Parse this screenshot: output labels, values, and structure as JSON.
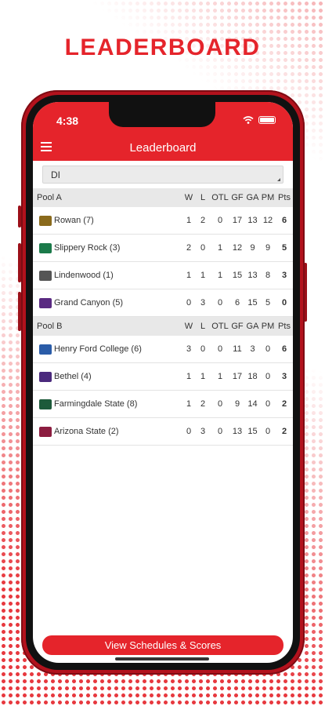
{
  "headline": "LEADERBOARD",
  "status": {
    "time": "4:38"
  },
  "nav": {
    "title": "Leaderboard"
  },
  "filter": {
    "selected": "DI"
  },
  "columns": [
    "W",
    "L",
    "OTL",
    "GF",
    "GA",
    "PM",
    "Pts"
  ],
  "pools": [
    {
      "name": "Pool A",
      "teams": [
        {
          "name": "Rowan (7)",
          "logo_color": "#8a6a1c",
          "w": "1",
          "l": "2",
          "otl": "0",
          "gf": "17",
          "ga": "13",
          "pm": "12",
          "pts": "6"
        },
        {
          "name": "Slippery Rock (3)",
          "logo_color": "#1b7a4a",
          "w": "2",
          "l": "0",
          "otl": "1",
          "gf": "12",
          "ga": "9",
          "pm": "9",
          "pts": "5"
        },
        {
          "name": "Lindenwood (1)",
          "logo_color": "#555555",
          "w": "1",
          "l": "1",
          "otl": "1",
          "gf": "15",
          "ga": "13",
          "pm": "8",
          "pts": "3"
        },
        {
          "name": "Grand Canyon (5)",
          "logo_color": "#5a2a82",
          "w": "0",
          "l": "3",
          "otl": "0",
          "gf": "6",
          "ga": "15",
          "pm": "5",
          "pts": "0"
        }
      ]
    },
    {
      "name": "Pool B",
      "teams": [
        {
          "name": "Henry Ford College (6)",
          "logo_color": "#2a5ca8",
          "w": "3",
          "l": "0",
          "otl": "0",
          "gf": "11",
          "ga": "3",
          "pm": "0",
          "pts": "6"
        },
        {
          "name": "Bethel (4)",
          "logo_color": "#4b2a7d",
          "w": "1",
          "l": "1",
          "otl": "1",
          "gf": "17",
          "ga": "18",
          "pm": "0",
          "pts": "3"
        },
        {
          "name": "Farmingdale State (8)",
          "logo_color": "#1d5a3a",
          "w": "1",
          "l": "2",
          "otl": "0",
          "gf": "9",
          "ga": "14",
          "pm": "0",
          "pts": "2"
        },
        {
          "name": "Arizona State (2)",
          "logo_color": "#8c1d40",
          "w": "0",
          "l": "3",
          "otl": "0",
          "gf": "13",
          "ga": "15",
          "pm": "0",
          "pts": "2"
        }
      ]
    }
  ],
  "footer": {
    "button_label": "View Schedules & Scores"
  },
  "colors": {
    "accent": "#e5242b",
    "phone_frame": "#b3121d"
  }
}
